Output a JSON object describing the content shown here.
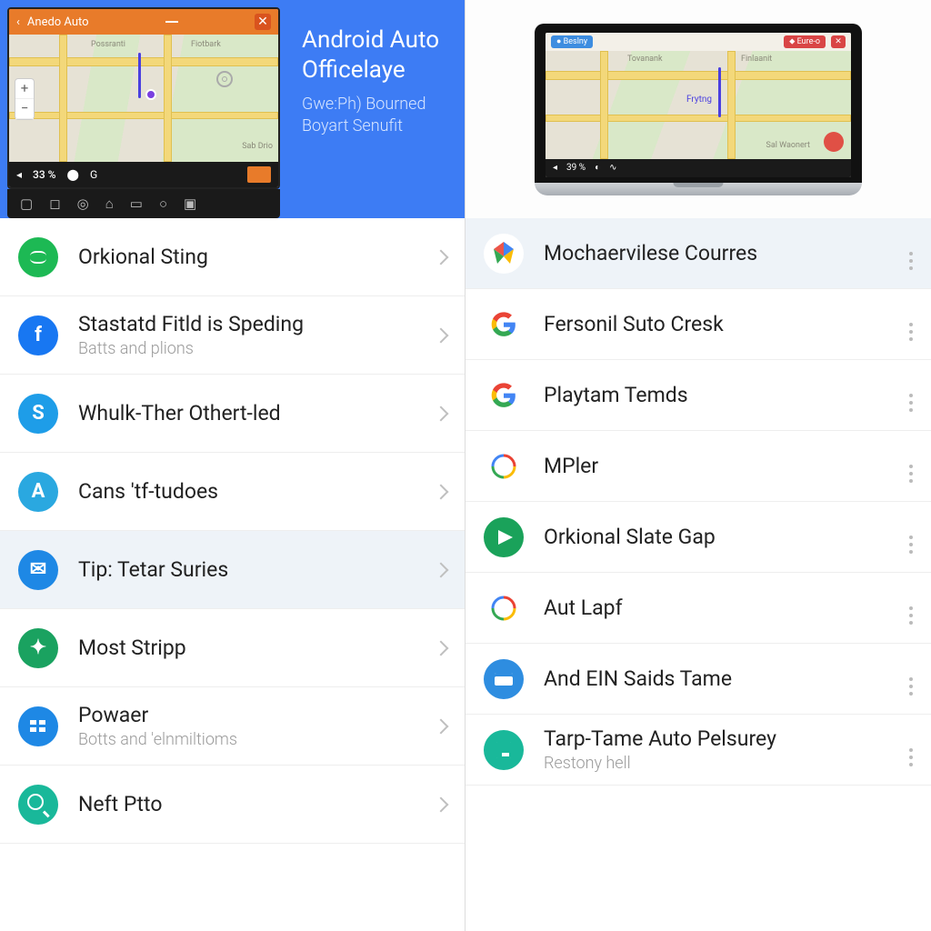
{
  "left": {
    "hero": {
      "titlebar": "Anedo Auto",
      "percent": "33 %",
      "heading1": "Android Auto",
      "heading2": "Officelaye",
      "line1": "Gwe:Ph) Bourned",
      "line2": "Boyart Senufit"
    },
    "items": [
      {
        "icon": "spotify",
        "title": "Orkional Sting"
      },
      {
        "icon": "fb",
        "title": "Stastatd Fitld is Speding",
        "sub": "Batts and plions",
        "glyph": "f"
      },
      {
        "icon": "s",
        "title": "Whulk-Ther Othert-led",
        "glyph": "S"
      },
      {
        "icon": "a",
        "title": "Cans 'tf-tudoes",
        "glyph": "A"
      },
      {
        "icon": "mail",
        "title": "Tip: Tetar Suries",
        "selected": true,
        "glyph": "✉"
      },
      {
        "icon": "run",
        "title": "Most Stripp",
        "glyph": "✦"
      },
      {
        "icon": "grid",
        "title": "Powaer",
        "sub": "Botts and 'elnmiltioms"
      },
      {
        "icon": "srch",
        "title": "Neft Ptto"
      }
    ]
  },
  "right": {
    "hero": {
      "percent": "39 %"
    },
    "items": [
      {
        "icon": "p",
        "title": "Mochaervilese Courres",
        "selected": true
      },
      {
        "icon": "g",
        "title": "Fersonil Suto Cresk"
      },
      {
        "icon": "g",
        "title": "Playtam Temds"
      },
      {
        "icon": "c",
        "title": "MPler"
      },
      {
        "icon": "send",
        "title": "Orkional Slate Gap"
      },
      {
        "icon": "c",
        "title": "Aut Lapf"
      },
      {
        "icon": "card",
        "title": "And EIN Saids Tame"
      },
      {
        "icon": "sheet",
        "title": "Tarp-Tame Auto Pelsurey",
        "sub": "Restony hell"
      }
    ]
  }
}
